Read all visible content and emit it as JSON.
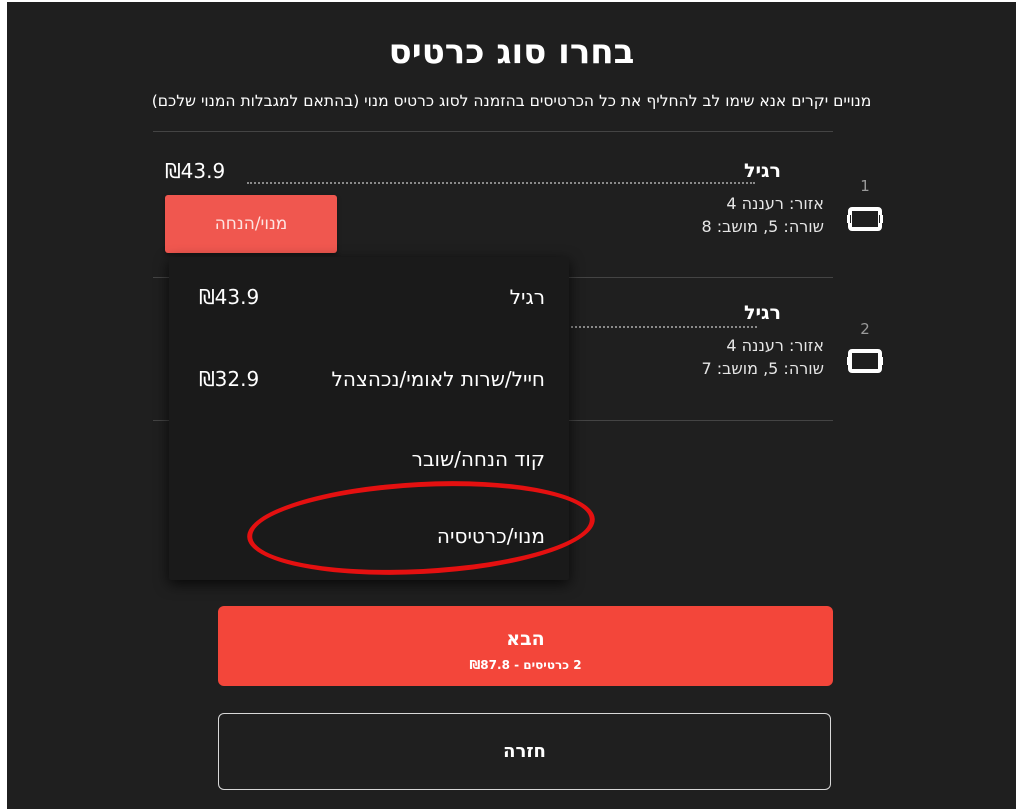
{
  "header": {
    "title": "בחרו סוג כרטיס",
    "subtitle": "מנויים יקרים אנא שימו לב להחליף את כל הכרטיסים בהזמנה לסוג כרטיס מנוי (בהתאם למגבלות המנוי שלכם)"
  },
  "tickets": [
    {
      "index": "1",
      "type": "רגיל",
      "area": "אזור: רעננה 4",
      "seat": "שורה: 5, מושב: 8",
      "price": "₪43.9",
      "discount_button": "מנוי/הנחה"
    },
    {
      "index": "2",
      "type": "רגיל",
      "area": "אזור: רעננה 4",
      "seat": "שורה: 5, מושב: 7"
    }
  ],
  "dropdown": {
    "options": [
      {
        "label": "רגיל",
        "price": "₪43.9"
      },
      {
        "label": "חייל/שרות לאומי/נכהצהל",
        "price": "₪32.9"
      },
      {
        "label": "קוד הנחה/שובר",
        "price": ""
      },
      {
        "label": "מנוי/כרטיסיה",
        "price": ""
      }
    ]
  },
  "footer": {
    "next_label": "הבא",
    "next_summary": "2 כרטיסים - ₪87.8",
    "back_label": "חזרה"
  },
  "colors": {
    "background": "#1f1f1f",
    "accent": "#f3463a",
    "discount_button": "#f0574f",
    "highlight_ellipse": "#e41010"
  },
  "icons": {
    "ticket": "ticket-icon"
  }
}
